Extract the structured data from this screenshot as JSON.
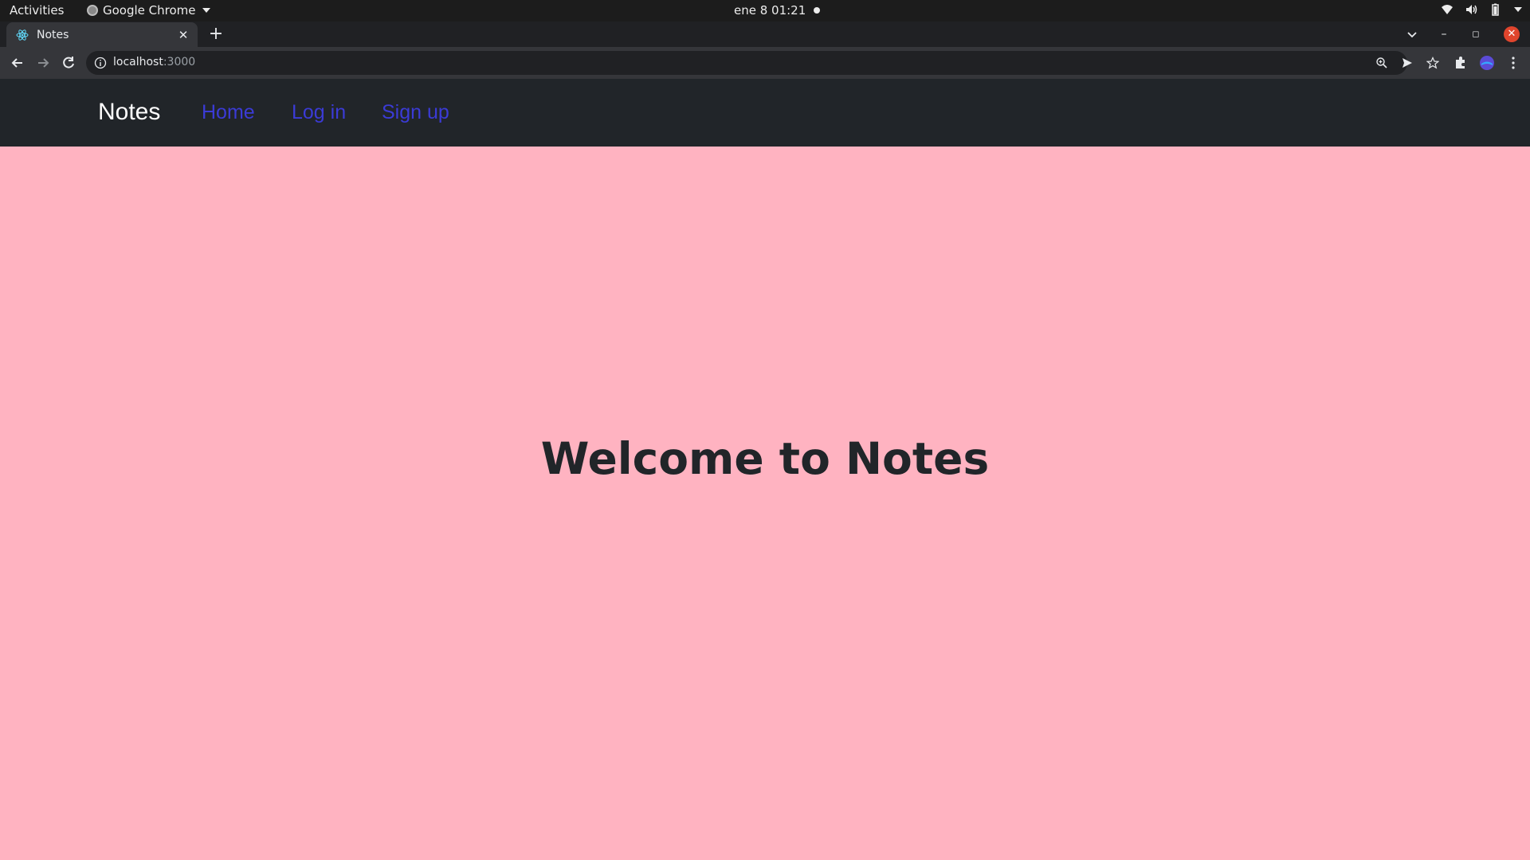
{
  "system_bar": {
    "activities": "Activities",
    "app_name": "Google Chrome",
    "clock": "ene 8  01:21"
  },
  "browser": {
    "tab_title": "Notes",
    "url_host": "localhost",
    "url_port": ":3000"
  },
  "navbar": {
    "brand": "Notes",
    "links": [
      "Home",
      "Log in",
      "Sign up"
    ],
    "link_color": "#3b3bd6",
    "background": "#212529"
  },
  "main": {
    "heading": "Welcome to Notes",
    "background": "#ffb3c1"
  }
}
